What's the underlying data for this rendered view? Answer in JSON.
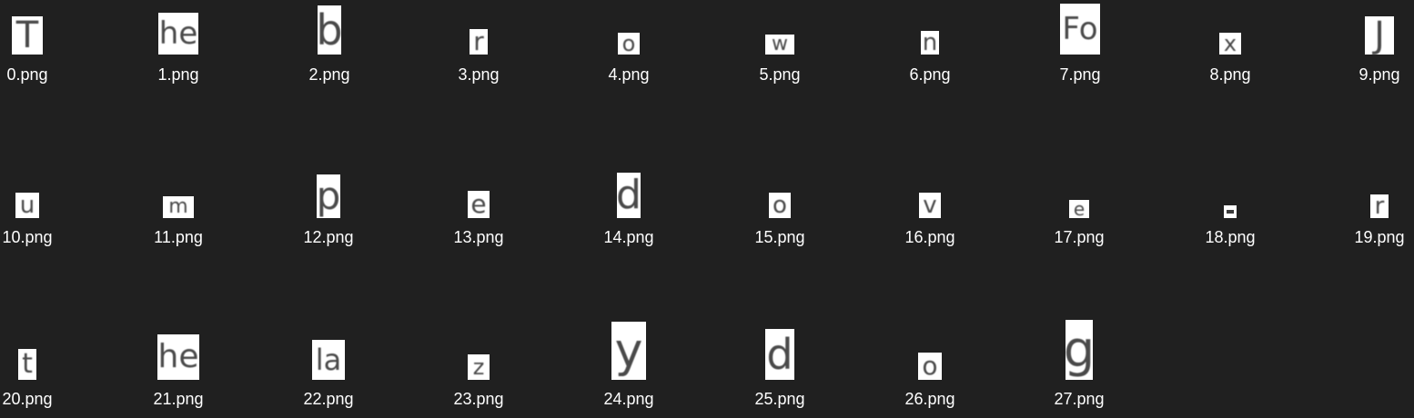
{
  "files": [
    {
      "name": "0.png",
      "letter": "T"
    },
    {
      "name": "1.png",
      "letter": "he"
    },
    {
      "name": "2.png",
      "letter": "b"
    },
    {
      "name": "3.png",
      "letter": "r"
    },
    {
      "name": "4.png",
      "letter": "o"
    },
    {
      "name": "5.png",
      "letter": "w"
    },
    {
      "name": "6.png",
      "letter": "n"
    },
    {
      "name": "7.png",
      "letter": "Fo"
    },
    {
      "name": "8.png",
      "letter": "x"
    },
    {
      "name": "9.png",
      "letter": "J"
    },
    {
      "name": "10.png",
      "letter": "u"
    },
    {
      "name": "11.png",
      "letter": "m"
    },
    {
      "name": "12.png",
      "letter": "p"
    },
    {
      "name": "13.png",
      "letter": "e"
    },
    {
      "name": "14.png",
      "letter": "d"
    },
    {
      "name": "15.png",
      "letter": "o"
    },
    {
      "name": "16.png",
      "letter": "v"
    },
    {
      "name": "17.png",
      "letter": "e"
    },
    {
      "name": "18.png",
      "letter": ""
    },
    {
      "name": "19.png",
      "letter": "r"
    },
    {
      "name": "20.png",
      "letter": "t"
    },
    {
      "name": "21.png",
      "letter": "he"
    },
    {
      "name": "22.png",
      "letter": "la"
    },
    {
      "name": "23.png",
      "letter": "z"
    },
    {
      "name": "24.png",
      "letter": "y"
    },
    {
      "name": "25.png",
      "letter": "d"
    },
    {
      "name": "26.png",
      "letter": "o"
    },
    {
      "name": "27.png",
      "letter": "g"
    }
  ]
}
